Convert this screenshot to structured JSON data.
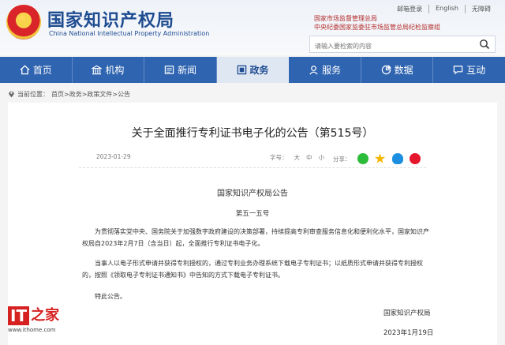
{
  "header": {
    "site_title": "国家知识产权局",
    "site_subtitle": "China National Intellectual Property Administration",
    "top_links": [
      "邮箱登录",
      "English",
      "无障碍"
    ],
    "org_line1": "国家市场监督管理总局",
    "org_line2": "中央纪委国家监委驻市场监管总局纪检监察组",
    "search_placeholder": "请输入要检索的内容"
  },
  "nav": [
    {
      "label": "首页",
      "icon": "home-icon"
    },
    {
      "label": "机构",
      "icon": "building-icon"
    },
    {
      "label": "新闻",
      "icon": "news-icon"
    },
    {
      "label": "政务",
      "icon": "government-icon",
      "active": true
    },
    {
      "label": "服务",
      "icon": "service-icon"
    },
    {
      "label": "数据",
      "icon": "data-icon"
    },
    {
      "label": "互动",
      "icon": "chat-icon"
    }
  ],
  "breadcrumb": {
    "prefix": "当前位置：",
    "path": "首页>政务>政策文件>公告"
  },
  "article": {
    "title": "关于全面推行专利证书电子化的公告（第515号）",
    "date": "2023-01-29",
    "font_label": "字号：",
    "font_sizes": [
      "大",
      "中",
      "小"
    ],
    "share_label": "分享：",
    "doc_header": "国家知识产权局公告",
    "doc_number": "第五一五号",
    "paragraphs": [
      "为贯彻落实党中央、国务院关于加强数字政府建设的决策部署，持续提高专利审查服务信息化和便利化水平，国家知识产权局自2023年2月7日（含当日）起，全面推行专利证书电子化。",
      "当事人以电子形式申请并获得专利授权的，通过专利业务办理系统下载电子专利证书；以纸质形式申请并获得专利授权的，按照《领取电子专利证书通知书》中告知的方式下载电子专利证书。",
      "特此公告。"
    ],
    "signature": "国家知识产权局",
    "signature_date": "2023年1月19日"
  },
  "watermark": {
    "logo_it": "IT",
    "logo_zh": "之家",
    "url": "www.ithome.com"
  },
  "colors": {
    "nav_bg": "#2f64b0",
    "title_blue": "#1f4c91",
    "org_red": "#b32b2b",
    "watermark_red": "#d62121"
  }
}
